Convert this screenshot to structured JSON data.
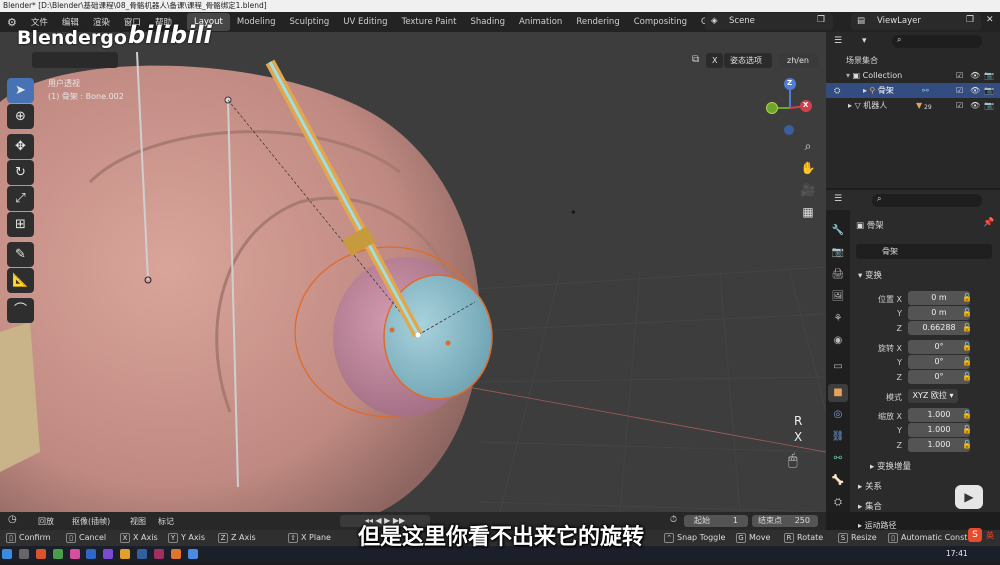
{
  "title_bar": "Blender* [D:\\Blender\\基础课程\\08_骨骼机器人\\备课\\课程_骨骼绑定1.blend]",
  "menu": [
    "文件",
    "编辑",
    "渲染",
    "窗口",
    "帮助"
  ],
  "workspaces": [
    "Layout",
    "Modeling",
    "Sculpting",
    "UV Editing",
    "Texture Paint",
    "Shading",
    "Animation",
    "Rendering",
    "Compositing",
    "Geometr"
  ],
  "active_workspace": "Layout",
  "scene": "Scene",
  "view_layer": "ViewLayer",
  "watermark": {
    "logo": "Blendergo",
    "bili": "bilibili"
  },
  "viewport": {
    "view_name": "用户透视",
    "object_info": "(1) 骨架 : Bone.002",
    "transform_orientation": "姿态选项",
    "lang_toggle": "zh/en",
    "axis_x": "X",
    "axis_gizmo": {
      "z": "Z",
      "y": "Y",
      "x": "X"
    },
    "cursor_axis_labels": [
      "R",
      "X"
    ]
  },
  "outliner": {
    "root": "场景集合",
    "collection": "Collection",
    "armature": "骨架",
    "robot": "机器人",
    "robot_count": "29"
  },
  "properties": {
    "object_name": "骨架",
    "data_name": "骨架",
    "transform_section": "变换",
    "location": {
      "label": "位置 X",
      "x": "0 m",
      "y": "0 m",
      "z": "0.66288"
    },
    "rotation": {
      "label": "旋转 X",
      "x": "0°",
      "y": "0°",
      "z": "0°"
    },
    "mode_label": "模式",
    "mode_value": "XYZ 欧拉",
    "scale": {
      "label": "缩放 X",
      "x": "1.000",
      "y": "1.000",
      "z": "1.000"
    },
    "axis_y": "Y",
    "axis_z": "Z",
    "delta": "变换增量",
    "relations": "关系",
    "collections": "集合",
    "motion_paths": "运动路径"
  },
  "timeline": {
    "playback": "回放",
    "keying": "抠像(插帧)",
    "view": "视图",
    "marker": "标记",
    "start_label": "起始",
    "start_value": "1",
    "end_label": "结束点",
    "end_value": "250"
  },
  "status": {
    "confirm": "Confirm",
    "cancel": "Cancel",
    "x_axis": "X Axis",
    "y_axis": "Y Axis",
    "z_axis": "Z Axis",
    "x_plane": "X Plane",
    "snap_toggle": "Snap Toggle",
    "move": "Move",
    "rotate": "Rotate",
    "resize": "Resize",
    "auto_const": "Automatic Const"
  },
  "subtitle": "但是这里你看不出来它的旋转",
  "clock": "17:41",
  "ime": "英"
}
